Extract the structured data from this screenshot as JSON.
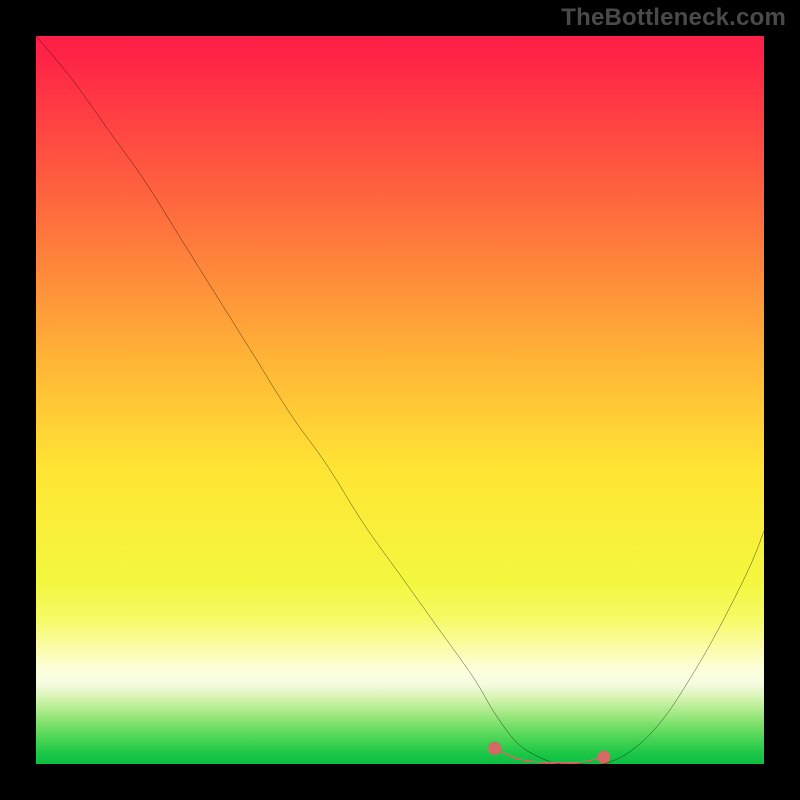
{
  "watermark": "TheBottleneck.com",
  "chart_data": {
    "type": "line",
    "title": "",
    "xlabel": "",
    "ylabel": "",
    "xlim": [
      0,
      100
    ],
    "ylim": [
      0,
      100
    ],
    "grid": false,
    "series": [
      {
        "name": "bottleneck-curve",
        "x": [
          0,
          5,
          10,
          15,
          20,
          25,
          30,
          35,
          40,
          45,
          50,
          55,
          60,
          63,
          66,
          69,
          72,
          75,
          78,
          82,
          86,
          90,
          94,
          98,
          100
        ],
        "y": [
          100,
          94,
          87,
          80,
          72,
          64,
          56,
          48,
          41,
          33,
          26,
          19,
          12,
          7,
          3,
          1,
          0,
          0,
          0,
          2,
          6,
          12,
          19,
          27,
          32
        ]
      }
    ],
    "highlight_segment": {
      "name": "optimal-range",
      "color": "#d46a63",
      "x": [
        63,
        66,
        69,
        72,
        75,
        78
      ],
      "y": [
        2.2,
        0.8,
        0.3,
        0.2,
        0.3,
        1.0
      ]
    },
    "background_gradient": {
      "direction": "vertical",
      "stops": [
        {
          "pos": 0.0,
          "color": "#ff1f47"
        },
        {
          "pos": 0.03,
          "color": "#ff2446"
        },
        {
          "pos": 0.25,
          "color": "#ff6f3d"
        },
        {
          "pos": 0.45,
          "color": "#ffb636"
        },
        {
          "pos": 0.6,
          "color": "#ffe634"
        },
        {
          "pos": 0.75,
          "color": "#f3f73f"
        },
        {
          "pos": 0.8,
          "color": "#f6fa65"
        },
        {
          "pos": 0.84,
          "color": "#fbfca9"
        },
        {
          "pos": 0.87,
          "color": "#fefedc"
        },
        {
          "pos": 0.89,
          "color": "#f4fce0"
        },
        {
          "pos": 0.91,
          "color": "#d3f4af"
        },
        {
          "pos": 0.93,
          "color": "#a3ea84"
        },
        {
          "pos": 0.95,
          "color": "#6fde65"
        },
        {
          "pos": 0.97,
          "color": "#3fd252"
        },
        {
          "pos": 0.985,
          "color": "#1dc748"
        },
        {
          "pos": 1.0,
          "color": "#0abf42"
        }
      ]
    }
  }
}
